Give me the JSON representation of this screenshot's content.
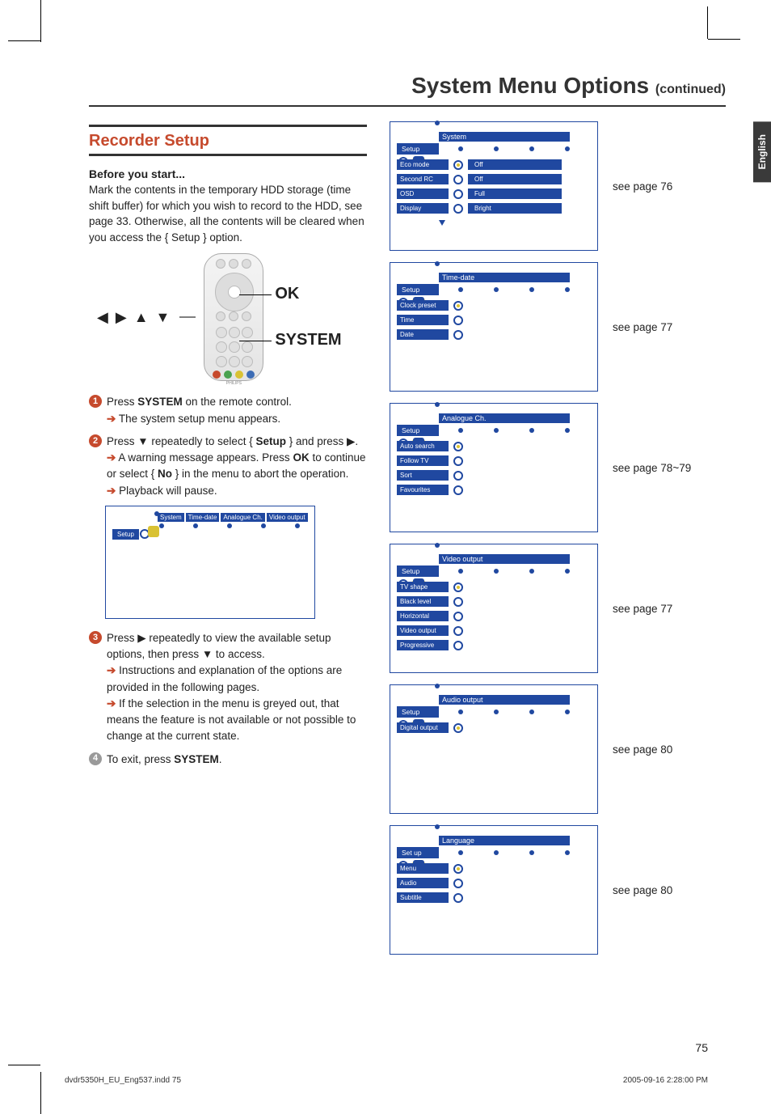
{
  "page": {
    "title_main": "System Menu Options",
    "title_cont": "(continued)",
    "number": "75",
    "lang_tab": "English",
    "footer_file": "dvdr5350H_EU_Eng537.indd   75",
    "footer_time": "2005-09-16   2:28:00 PM"
  },
  "left": {
    "section_title": "Recorder Setup",
    "before_head": "Before you start...",
    "before_body": "Mark the contents in the temporary HDD storage (time shift buffer) for which you wish to record to the HDD, see page 33. Otherwise, all the contents will be cleared when you access the { Setup } option.",
    "remote": {
      "nav_glyphs": "◀ ▶ ▲ ▼",
      "ok": "OK",
      "system": "SYSTEM",
      "brand": "PHILIPS"
    },
    "step1_a": "Press ",
    "step1_bold": "SYSTEM",
    "step1_b": " on the remote control.",
    "step1_res": " The system setup menu appears.",
    "step2_a": "Press ▼ repeatedly to select { ",
    "step2_bold": "Setup",
    "step2_b": " } and press ▶.",
    "step2_res1_a": " A warning message appears. Press ",
    "step2_res1_ok": "OK",
    "step2_res1_b": " to continue or select { ",
    "step2_res1_no": "No",
    "step2_res1_c": " } in the menu to abort the operation.",
    "step2_res2": " Playback will pause.",
    "mini_tabs": [
      "System",
      "Time-date",
      "Analogue Ch.",
      "Video output"
    ],
    "mini_side": "Setup",
    "step3_a": "Press ▶ repeatedly to view the available setup options, then press ▼ to access.",
    "step3_res1": " Instructions and explanation of the options are provided in the following pages.",
    "step3_res2": " If the selection in the menu is greyed out, that means the feature is not available or not possible to change at the current state.",
    "step4_a": "To exit, press ",
    "step4_bold": "SYSTEM",
    "step4_b": "."
  },
  "right": {
    "cards": [
      {
        "title": "System",
        "side": "Setup",
        "items": [
          {
            "label": "Eco mode",
            "value": "Off"
          },
          {
            "label": "Second RC",
            "value": "Off"
          },
          {
            "label": "OSD",
            "value": "Full"
          },
          {
            "label": "Display",
            "value": "Bright"
          }
        ],
        "ref": "see page 76"
      },
      {
        "title": "Time-date",
        "side": "Setup",
        "items": [
          {
            "label": "Clock preset",
            "value": ""
          },
          {
            "label": "Time",
            "value": ""
          },
          {
            "label": "Date",
            "value": ""
          }
        ],
        "ref": "see page 77"
      },
      {
        "title": "Analogue Ch.",
        "side": "Setup",
        "items": [
          {
            "label": "Auto search",
            "value": ""
          },
          {
            "label": "Follow TV",
            "value": ""
          },
          {
            "label": "Sort",
            "value": ""
          },
          {
            "label": "Favourites",
            "value": ""
          }
        ],
        "ref": "see page 78~79"
      },
      {
        "title": "Video output",
        "side": "Setup",
        "items": [
          {
            "label": "TV shape",
            "value": ""
          },
          {
            "label": "Black level",
            "value": ""
          },
          {
            "label": "Horizontal",
            "value": ""
          },
          {
            "label": "Video output",
            "value": ""
          },
          {
            "label": "Progressive",
            "value": ""
          }
        ],
        "ref": "see page 77"
      },
      {
        "title": "Audio output",
        "side": "Setup",
        "items": [
          {
            "label": "Digital output",
            "value": ""
          }
        ],
        "ref": "see page 80"
      },
      {
        "title": "Language",
        "side": "Set up",
        "items": [
          {
            "label": "Menu",
            "value": ""
          },
          {
            "label": "Audio",
            "value": ""
          },
          {
            "label": "Subtitle",
            "value": ""
          }
        ],
        "ref": "see page 80"
      }
    ]
  }
}
